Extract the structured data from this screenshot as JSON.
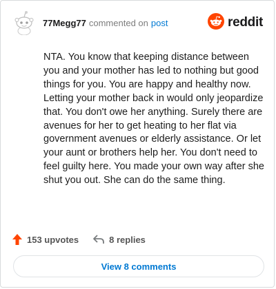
{
  "comment": {
    "username": "77Megg77",
    "action_text": "commented on",
    "target_link": "post",
    "body": "NTA. You know that keeping distance between you and your mother has led to nothing but good things for you. You are happy and healthy now. Letting your mother back in would only jeopardize that. You don't owe her anything. Surely there are avenues for her to get heating to her flat via government avenues or elderly assistance. Or let your aunt or brothers help her. You don't need to feel guilty here. You made your own way after she shut you out. She can do the same thing."
  },
  "brand": {
    "name": "reddit",
    "accent": "#ff4500"
  },
  "actions": {
    "upvotes": "153 upvotes",
    "replies": "8 replies",
    "upvote_color": "#ff4500"
  },
  "view_button": {
    "label": "View 8 comments",
    "color": "#0079d3"
  },
  "icons": [
    "avatar-snoo-icon",
    "reddit-logo-icon",
    "upvote-arrow-icon",
    "reply-arrow-icon"
  ]
}
